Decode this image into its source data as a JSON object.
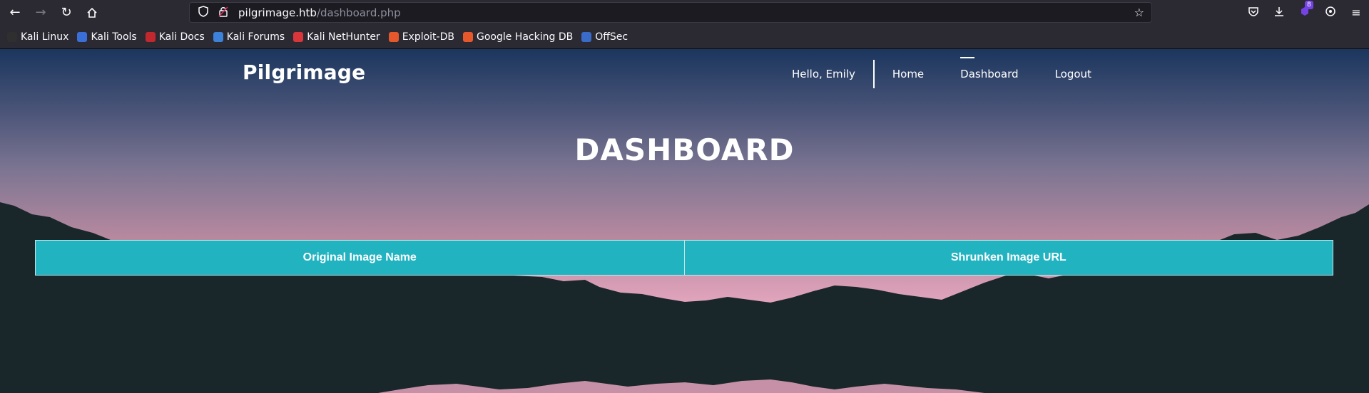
{
  "browser": {
    "url_host": "pilgrimage.htb",
    "url_path": "/dashboard.php",
    "extensions_badge": "8",
    "bookmarks": [
      {
        "label": "Kali Linux",
        "color": "#2f2f2f"
      },
      {
        "label": "Kali Tools",
        "color": "#3b6fd8"
      },
      {
        "label": "Kali Docs",
        "color": "#c0282d"
      },
      {
        "label": "Kali Forums",
        "color": "#3b82d8"
      },
      {
        "label": "Kali NetHunter",
        "color": "#d8363b"
      },
      {
        "label": "Exploit-DB",
        "color": "#e5582b"
      },
      {
        "label": "Google Hacking DB",
        "color": "#e5582b"
      },
      {
        "label": "OffSec",
        "color": "#3a6bc8"
      }
    ]
  },
  "site": {
    "brand": "Pilgrimage",
    "greeting": "Hello, Emily",
    "nav": [
      {
        "label": "Home",
        "active": false
      },
      {
        "label": "Dashboard",
        "active": true
      },
      {
        "label": "Logout",
        "active": false
      }
    ],
    "page_title": "DASHBOARD",
    "table": {
      "headers": [
        "Original Image Name",
        "Shrunken Image URL"
      ],
      "header_color": "#22b3c1"
    }
  }
}
